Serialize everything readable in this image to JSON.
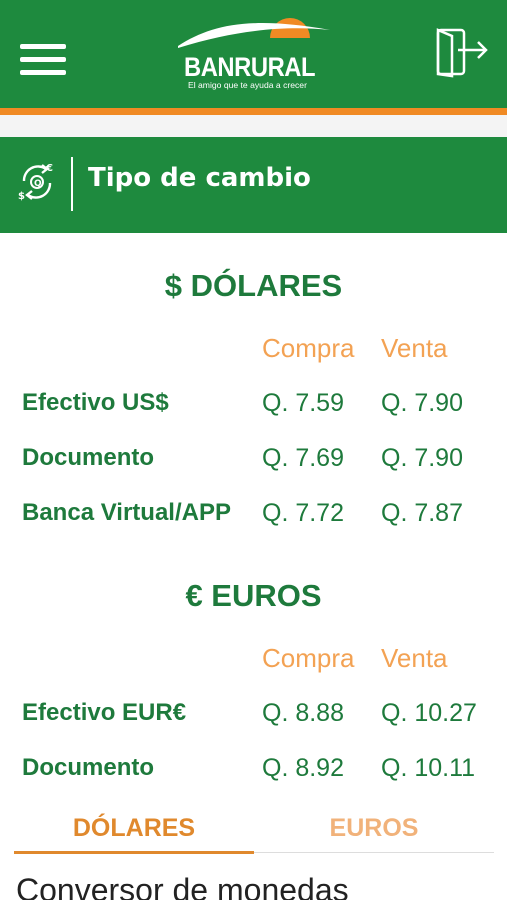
{
  "header": {
    "menu_icon": "hamburger-menu-icon",
    "logo": {
      "name": "BANRURAL",
      "tagline": "El amigo que te ayuda a crecer"
    },
    "exit_icon": "logout-door-icon"
  },
  "section": {
    "icon": "currency-exchange-icon",
    "title": "Tipo de cambio"
  },
  "dolares": {
    "title": "$ DÓLARES",
    "headers": {
      "compra": "Compra",
      "venta": "Venta"
    },
    "rows": [
      {
        "label": "Efectivo US$",
        "compra": "Q. 7.59",
        "venta": "Q. 7.90"
      },
      {
        "label": "Documento",
        "compra": "Q. 7.69",
        "venta": "Q. 7.90"
      },
      {
        "label": "Banca Virtual/APP",
        "compra": "Q. 7.72",
        "venta": "Q. 7.87"
      }
    ]
  },
  "euros": {
    "title": "€ EUROS",
    "headers": {
      "compra": "Compra",
      "venta": "Venta"
    },
    "rows": [
      {
        "label": "Efectivo EUR€",
        "compra": "Q. 8.88",
        "venta": "Q. 10.27"
      },
      {
        "label": "Documento",
        "compra": "Q. 8.92",
        "venta": "Q. 10.11"
      }
    ]
  },
  "tabs": [
    {
      "label": "DÓLARES",
      "active": true
    },
    {
      "label": "EUROS",
      "active": false
    }
  ],
  "converter": {
    "title": "Conversor de monedas"
  },
  "colors": {
    "brand_green": "#1e8a3e",
    "text_green": "#1e7a3c",
    "accent_orange": "#f08a24",
    "header_orange": "#f3a253"
  }
}
